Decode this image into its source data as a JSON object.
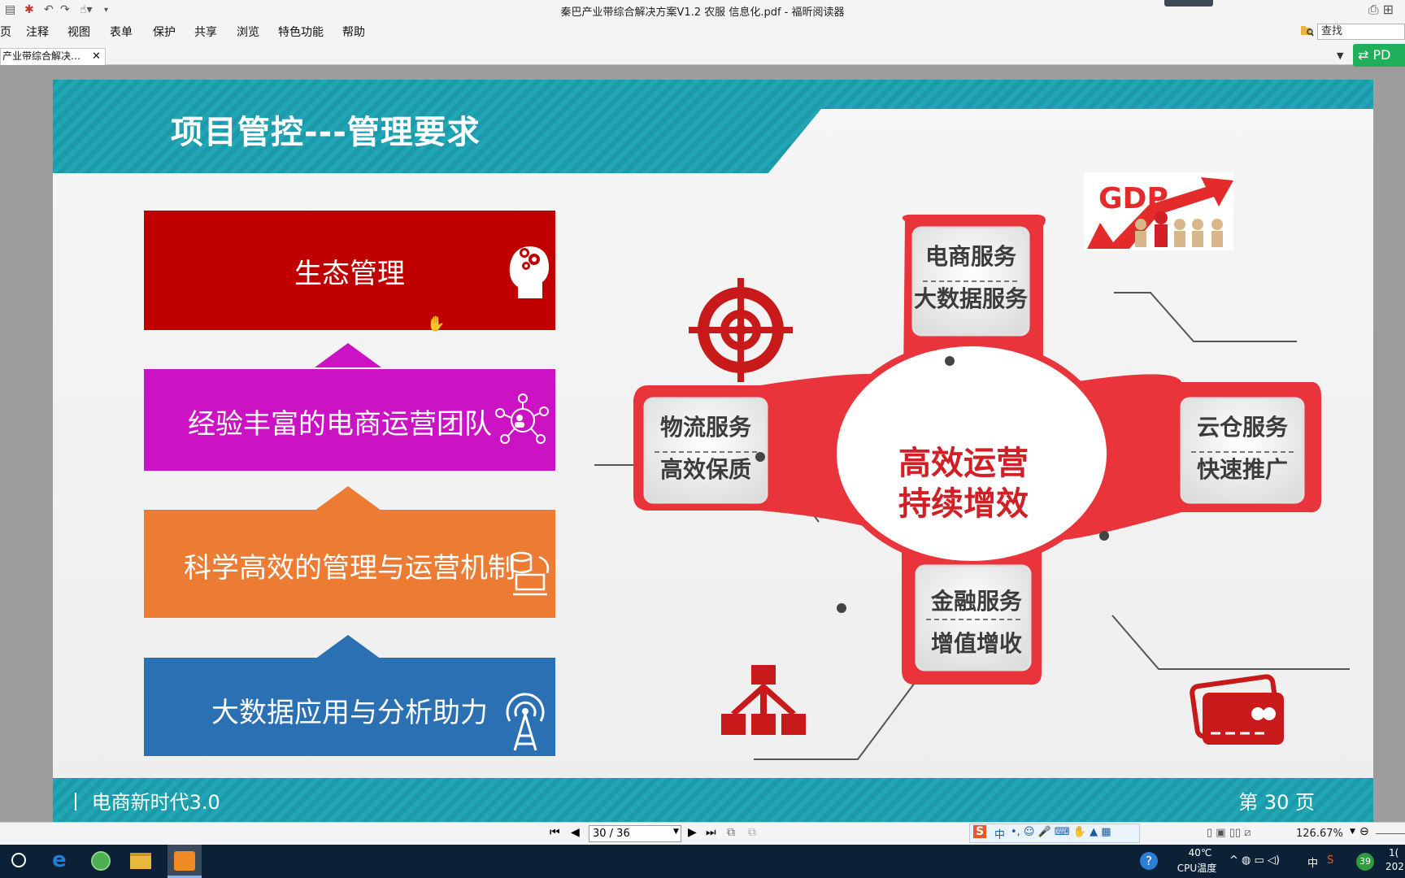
{
  "window": {
    "title": "秦巴产业带综合解决方案V1.2  农服 信息化.pdf - 福昕阅读器",
    "restore_icons": "⎙  ⊞"
  },
  "menu": {
    "items": [
      "页",
      "注释",
      "视图",
      "表单",
      "保护",
      "共享",
      "浏览",
      "特色功能",
      "帮助"
    ],
    "search_placeholder": "查找"
  },
  "tabs": {
    "active_label": "产业带综合解决…",
    "close_glyph": "✕",
    "badge": "PD"
  },
  "slide": {
    "title": "项目管控---管理要求",
    "bars": [
      {
        "label": "生态管理",
        "color": "#c00000"
      },
      {
        "label": "经验丰富的电商运营团队",
        "color": "#cc13c4"
      },
      {
        "label": "科学高效的管理与运营机制",
        "color": "#ec7b34"
      },
      {
        "label": "大数据应用与分析助力",
        "color": "#2a70b3"
      }
    ],
    "center": {
      "line1": "高效运营",
      "line2": "持续增效"
    },
    "petals": {
      "top": {
        "line1": "电商服务",
        "line2": "大数据服务"
      },
      "left": {
        "line1": "物流服务",
        "line2": "高效保质"
      },
      "right": {
        "line1": "云仓服务",
        "line2": "快速推广"
      },
      "bottom": {
        "line1": "金融服务",
        "line2": "增值增收"
      }
    },
    "gdp_label": "GDP",
    "footer_left": "丨 电商新时代3.0",
    "footer_right": "第 30 页",
    "accent_color": "#20a6b5"
  },
  "nav": {
    "page_field": "30 / 36",
    "zoom": "126.67%"
  },
  "taskbar": {
    "temperature": "40℃",
    "temperature_label": "CPU温度",
    "ime": "中",
    "badge_count": "39",
    "clock_fragment": "1(",
    "date_fragment": "202"
  }
}
